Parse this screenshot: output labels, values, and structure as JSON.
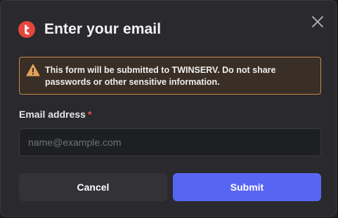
{
  "dialog": {
    "title": "Enter your email",
    "logo_icon": "twinserv-logo-icon",
    "close_icon": "close-icon",
    "accent_color": "#5865f2",
    "logo_color": "#e8453c"
  },
  "warning": {
    "icon": "warning-triangle-icon",
    "text": "This form will be submitted to TWINSERV. Do not share passwords or other sensitive information.",
    "border_color": "#c88a4a"
  },
  "email_field": {
    "label": "Email address",
    "required_marker": "*",
    "placeholder": "name@example.com",
    "value": ""
  },
  "buttons": {
    "cancel_label": "Cancel",
    "submit_label": "Submit"
  }
}
